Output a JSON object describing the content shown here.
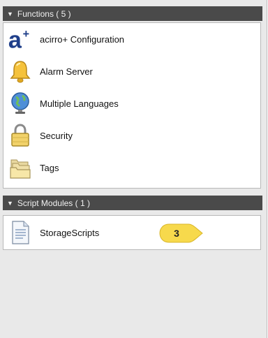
{
  "functions_header": {
    "label": "Functions ( 5 )"
  },
  "functions": [
    {
      "label": "acirro+ Configuration",
      "icon": "acirro-logo-icon"
    },
    {
      "label": "Alarm Server",
      "icon": "bell-icon"
    },
    {
      "label": "Multiple Languages",
      "icon": "globe-icon"
    },
    {
      "label": "Security",
      "icon": "padlock-icon"
    },
    {
      "label": "Tags",
      "icon": "folder-stack-icon"
    }
  ],
  "scripts_header": {
    "label": "Script Modules ( 1 )"
  },
  "scripts": [
    {
      "label": "StorageScripts",
      "icon": "document-icon"
    }
  ],
  "callout": {
    "label": "3",
    "color": "#f7d94c"
  },
  "colors": {
    "header_bg": "#4a4a4a",
    "panel_bg": "#e9e9e9",
    "brand": "#1f3f8a"
  }
}
